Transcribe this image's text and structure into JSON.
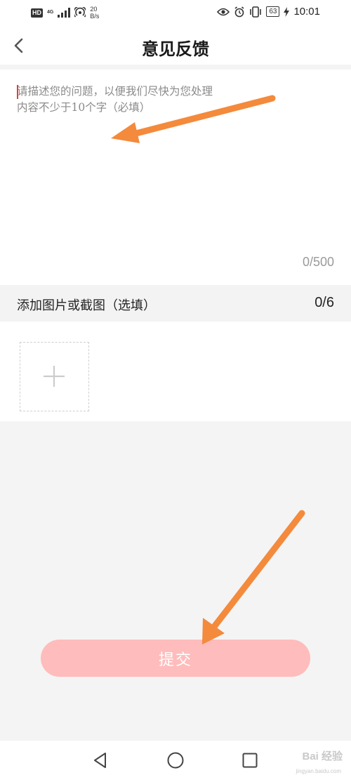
{
  "status_bar": {
    "hd": "HD",
    "network": "4G",
    "speed_value": "20",
    "speed_unit": "B/s",
    "battery": "63",
    "time": "10:01"
  },
  "header": {
    "title": "意见反馈",
    "back_icon": "chevron-left-icon"
  },
  "feedback": {
    "placeholder": "请描述您的问题，以便我们尽快为您处理\n内容不少于10个字（必填）",
    "value": "",
    "counter": "0/500",
    "caret_color": "#e0403a"
  },
  "images": {
    "label": "添加图片或截图（选填）",
    "counter": "0/6",
    "add_icon": "plus-icon"
  },
  "submit": {
    "label": "提交",
    "color": "#ffbcbc"
  },
  "annotations": {
    "arrow_color": "#f48a3c"
  },
  "system_nav": {
    "back_icon": "triangle-back-icon",
    "home_icon": "circle-home-icon",
    "recent_icon": "square-recent-icon"
  },
  "watermark": {
    "text": "Bai 经验",
    "sub": "jingyan.baidu.com"
  }
}
